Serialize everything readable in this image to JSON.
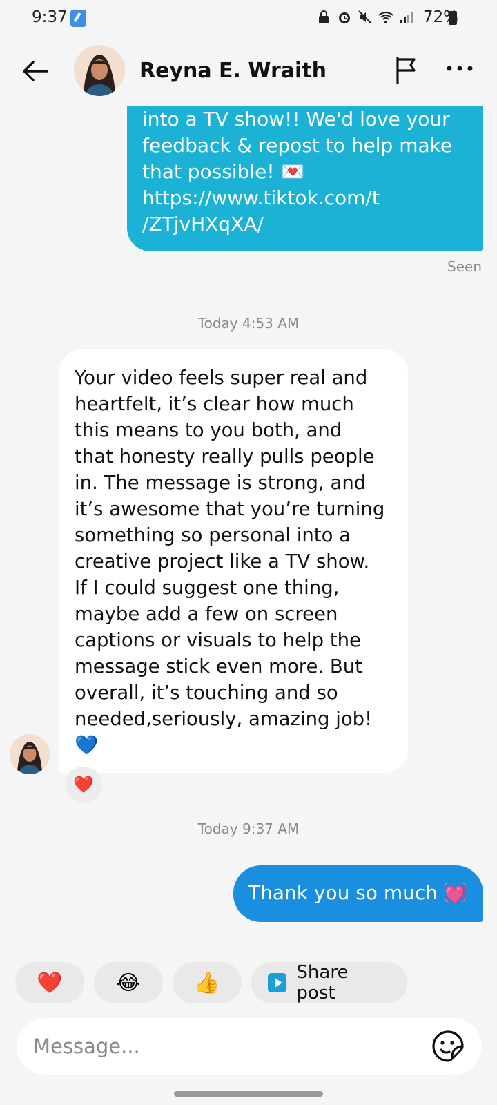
{
  "status_bar": {
    "time": "9:37",
    "battery": "72%"
  },
  "header": {
    "contact_name": "Reyna E. Wraith",
    "icons": {
      "back": "back-arrow-icon",
      "flag": "flag-icon",
      "more": "more-icon"
    }
  },
  "messages": {
    "sent_top": {
      "lines": [
        "into a TV show!! We'd love your",
        "feedback & repost to help make",
        "that possible! 💌",
        "https://www.tiktok.com/t",
        "/ZTjvHXqXA/"
      ],
      "status": "Seen"
    },
    "timestamp_1": "Today 4:53 AM",
    "received": {
      "lines": [
        "Your video feels super real and",
        "heartfelt, it’s clear how much",
        "this means to you both, and",
        "that honesty really pulls people",
        "in. The message is strong, and",
        "it’s awesome that you’re turning",
        "something so personal into a",
        "creative project like a TV show.",
        "If I could suggest one thing,",
        "maybe add a few on screen",
        "captions or visuals to help the",
        "message stick even more. But",
        "overall, it’s touching and so",
        "needed,seriously, amazing job!",
        "💙"
      ],
      "reaction": "❤️"
    },
    "timestamp_2": "Today 9:37 AM",
    "reply": {
      "text": "Thank you so much",
      "emoji": "💓"
    }
  },
  "quick_reactions": {
    "heart": "❤️",
    "laugh": "😂",
    "thumbs_up": "👍",
    "share_label": "Share post"
  },
  "composer": {
    "placeholder": "Message..."
  },
  "colors": {
    "sent_bubble": "#1cb2d6",
    "reply_bubble": "#1a8fe0",
    "received_bubble": "#ffffff",
    "background": "#f5f5f5"
  }
}
